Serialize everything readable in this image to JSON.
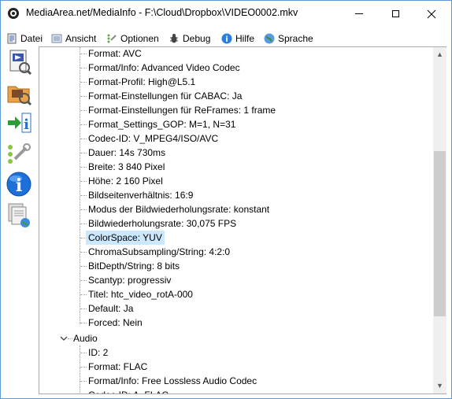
{
  "window": {
    "title": "MediaArea.net/MediaInfo - F:\\Cloud\\Dropbox\\VIDEO0002.mkv"
  },
  "menu": [
    {
      "label": "Datei",
      "icon": "file-icon"
    },
    {
      "label": "Ansicht",
      "icon": "view-icon"
    },
    {
      "label": "Optionen",
      "icon": "options-icon"
    },
    {
      "label": "Debug",
      "icon": "debug-icon"
    },
    {
      "label": "Hilfe",
      "icon": "help-icon"
    },
    {
      "label": "Sprache",
      "icon": "language-globe-icon"
    }
  ],
  "sidebar": [
    {
      "icon": "open-file-icon"
    },
    {
      "icon": "open-folder-icon"
    },
    {
      "icon": "export-icon"
    },
    {
      "icon": "preferences-icon"
    },
    {
      "icon": "about-info-icon"
    },
    {
      "icon": "file-web-icon"
    }
  ],
  "tree": {
    "video_fields": [
      "Format: AVC",
      "Format/Info: Advanced Video Codec",
      "Format-Profil: High@L5.1",
      "Format-Einstellungen für CABAC: Ja",
      "Format-Einstellungen für ReFrames: 1 frame",
      "Format_Settings_GOP: M=1, N=31",
      "Codec-ID: V_MPEG4/ISO/AVC",
      "Dauer: 14s 730ms",
      "Breite: 3 840 Pixel",
      "Höhe: 2 160 Pixel",
      "Bildseitenverhältnis: 16:9",
      "Modus der Bildwiederholungsrate: konstant",
      "Bildwiederholungsrate: 30,075 FPS",
      "ColorSpace: YUV",
      "ChromaSubsampling/String: 4:2:0",
      "BitDepth/String: 8 bits",
      "Scantyp: progressiv",
      "Titel: htc_video_rotA-000",
      "Default: Ja",
      "Forced: Nein"
    ],
    "selected_field": "ColorSpace: YUV",
    "audio_section": "Audio",
    "audio_fields": [
      "ID: 2",
      "Format: FLAC",
      "Format/Info: Free Lossless Audio Codec",
      "Codec-ID: A_FLAC"
    ]
  },
  "colors": {
    "selection": "#cce8ff",
    "window_border": "#5b9bd5"
  }
}
